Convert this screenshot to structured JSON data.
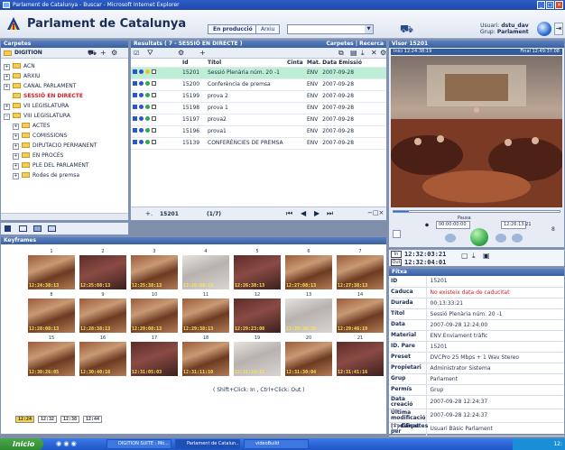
{
  "window": {
    "title": "Parlament de Catalunya - Buscar - Microsoft Internet Explorer"
  },
  "header": {
    "app_title": "Parlament de Catalunya",
    "mode_button": "En producció",
    "archive_button": "Arxiu",
    "user_label": "Usuari:",
    "user_value": "dstu_dav",
    "group_label": "Grup:",
    "group_value": "Parlament"
  },
  "carpetes": {
    "title": "Carpetes",
    "root": "DIGITION",
    "items": [
      "ACN",
      "ARXIU",
      "CANAL PARLAMENT",
      "SESSIÓ EN DIRECTE",
      "VII LEGISLATURA",
      "VIII LEGISLATURA",
      "ACTES",
      "COMISSIONS",
      "DIPUTACIO PERMANENT",
      "EN PROCÉS",
      "PLE DEL PARLAMENT",
      "Rodes de premsa"
    ]
  },
  "results": {
    "title": "Resultats ( 7 - SESSIÓ EN DIRECTE )",
    "title_right": "Carpetes | Recerca",
    "columns": [
      "Id",
      "Títol",
      "Cinta",
      "Mat.",
      "Data Emissió"
    ],
    "rows": [
      {
        "id": "15201",
        "title": "Sessió Plenària núm. 20 -1",
        "cinta": "",
        "mat": "ENV",
        "date": "2007-09-28"
      },
      {
        "id": "15200",
        "title": "Conferència de premsa",
        "cinta": "",
        "mat": "ENV",
        "date": "2007-09-28"
      },
      {
        "id": "15199",
        "title": "prova 2",
        "cinta": "",
        "mat": "ENV",
        "date": "2007-09-28"
      },
      {
        "id": "15198",
        "title": "prova 1",
        "cinta": "",
        "mat": "ENV",
        "date": "2007-09-28"
      },
      {
        "id": "15197",
        "title": "prova2",
        "cinta": "",
        "mat": "ENV",
        "date": "2007-09-28"
      },
      {
        "id": "15196",
        "title": "prova1",
        "cinta": "",
        "mat": "ENV",
        "date": "2007-09-28"
      },
      {
        "id": "15139",
        "title": "CONFERÈNCIES DE PREMSA",
        "cinta": "",
        "mat": "ENV",
        "date": "2007-09-28"
      }
    ],
    "current_id": "15201",
    "pager": "(1/7)"
  },
  "visor": {
    "title": "Visor 15201",
    "start_label": "Inici 12:24:38:19",
    "end_label": "Final 12:49:37:08",
    "pause_label": "Pausa",
    "time_left": "00:00:00:00",
    "time_right": "12:26:13:21",
    "page_num": "8",
    "in_label": "In",
    "in_time": "12:32:03:21",
    "out_label": "Out",
    "out_time": "12:32:04:01"
  },
  "keyframes": {
    "title": "Keyframes",
    "labels": [
      "1",
      "2",
      "3",
      "4",
      "5",
      "6",
      "7",
      "8",
      "9",
      "10",
      "11",
      "12",
      "13",
      "14",
      "15",
      "16",
      "17",
      "18",
      "19",
      "20",
      "21"
    ],
    "timestamps": [
      "12:24:38:13",
      "12:25:08:13",
      "12:25:38:13",
      "12:26:08:13",
      "12:26:38:13",
      "12:27:08:13",
      "12:27:38:13",
      "12:28:08:13",
      "12:28:38:13",
      "12:29:08:13",
      "12:29:38:13",
      "12:29:23:08",
      "12:29:36:29",
      "12:29:46:19",
      "12:30:26:05",
      "12:30:40:16",
      "12:31:05:03",
      "12:31:11:10",
      "12:31:24:11",
      "12:31:30:04",
      "12:31:41:16"
    ],
    "hint": "( Shift+Click: In , Ctrl+Click: Out )",
    "pages": [
      "12:24",
      "12:32",
      "12:38",
      "12:44"
    ]
  },
  "fitxa": {
    "title": "Fitxa",
    "fields": [
      {
        "k": "ID",
        "v": "15201"
      },
      {
        "k": "Caduca",
        "v": "No existeix data de caducitat"
      },
      {
        "k": "Durada",
        "v": "00:13:33:21"
      },
      {
        "k": "Títol",
        "v": "Sessió Plenària núm. 20 -1"
      },
      {
        "k": "Data",
        "v": "2007-09-28 12:24:00"
      },
      {
        "k": "Material",
        "v": "ENV Enviament tràfic"
      },
      {
        "k": "ID. Pare",
        "v": "15201"
      },
      {
        "k": "Preset",
        "v": "DVCPro 25 Mbps + 1 Wav Stereo"
      },
      {
        "k": "Propietari",
        "v": "Administrator Sistema"
      },
      {
        "k": "Grup",
        "v": "Parlament"
      },
      {
        "k": "Permís",
        "v": "Grup"
      },
      {
        "k": "Data creació",
        "v": "2007-09-28 12:24:37"
      },
      {
        "k": "Última modificació",
        "v": "2007-09-28 12:24:37"
      },
      {
        "k": "Modificat per",
        "v": "Usuari Bàsic Parlament"
      }
    ],
    "footer": "Carpetes"
  },
  "taskbar": {
    "start": "Inicio",
    "tasks": [
      "DIGITION SUITE : Mó...",
      "Parlament de Catalun...",
      "videoBuild"
    ],
    "clock": "12:"
  }
}
